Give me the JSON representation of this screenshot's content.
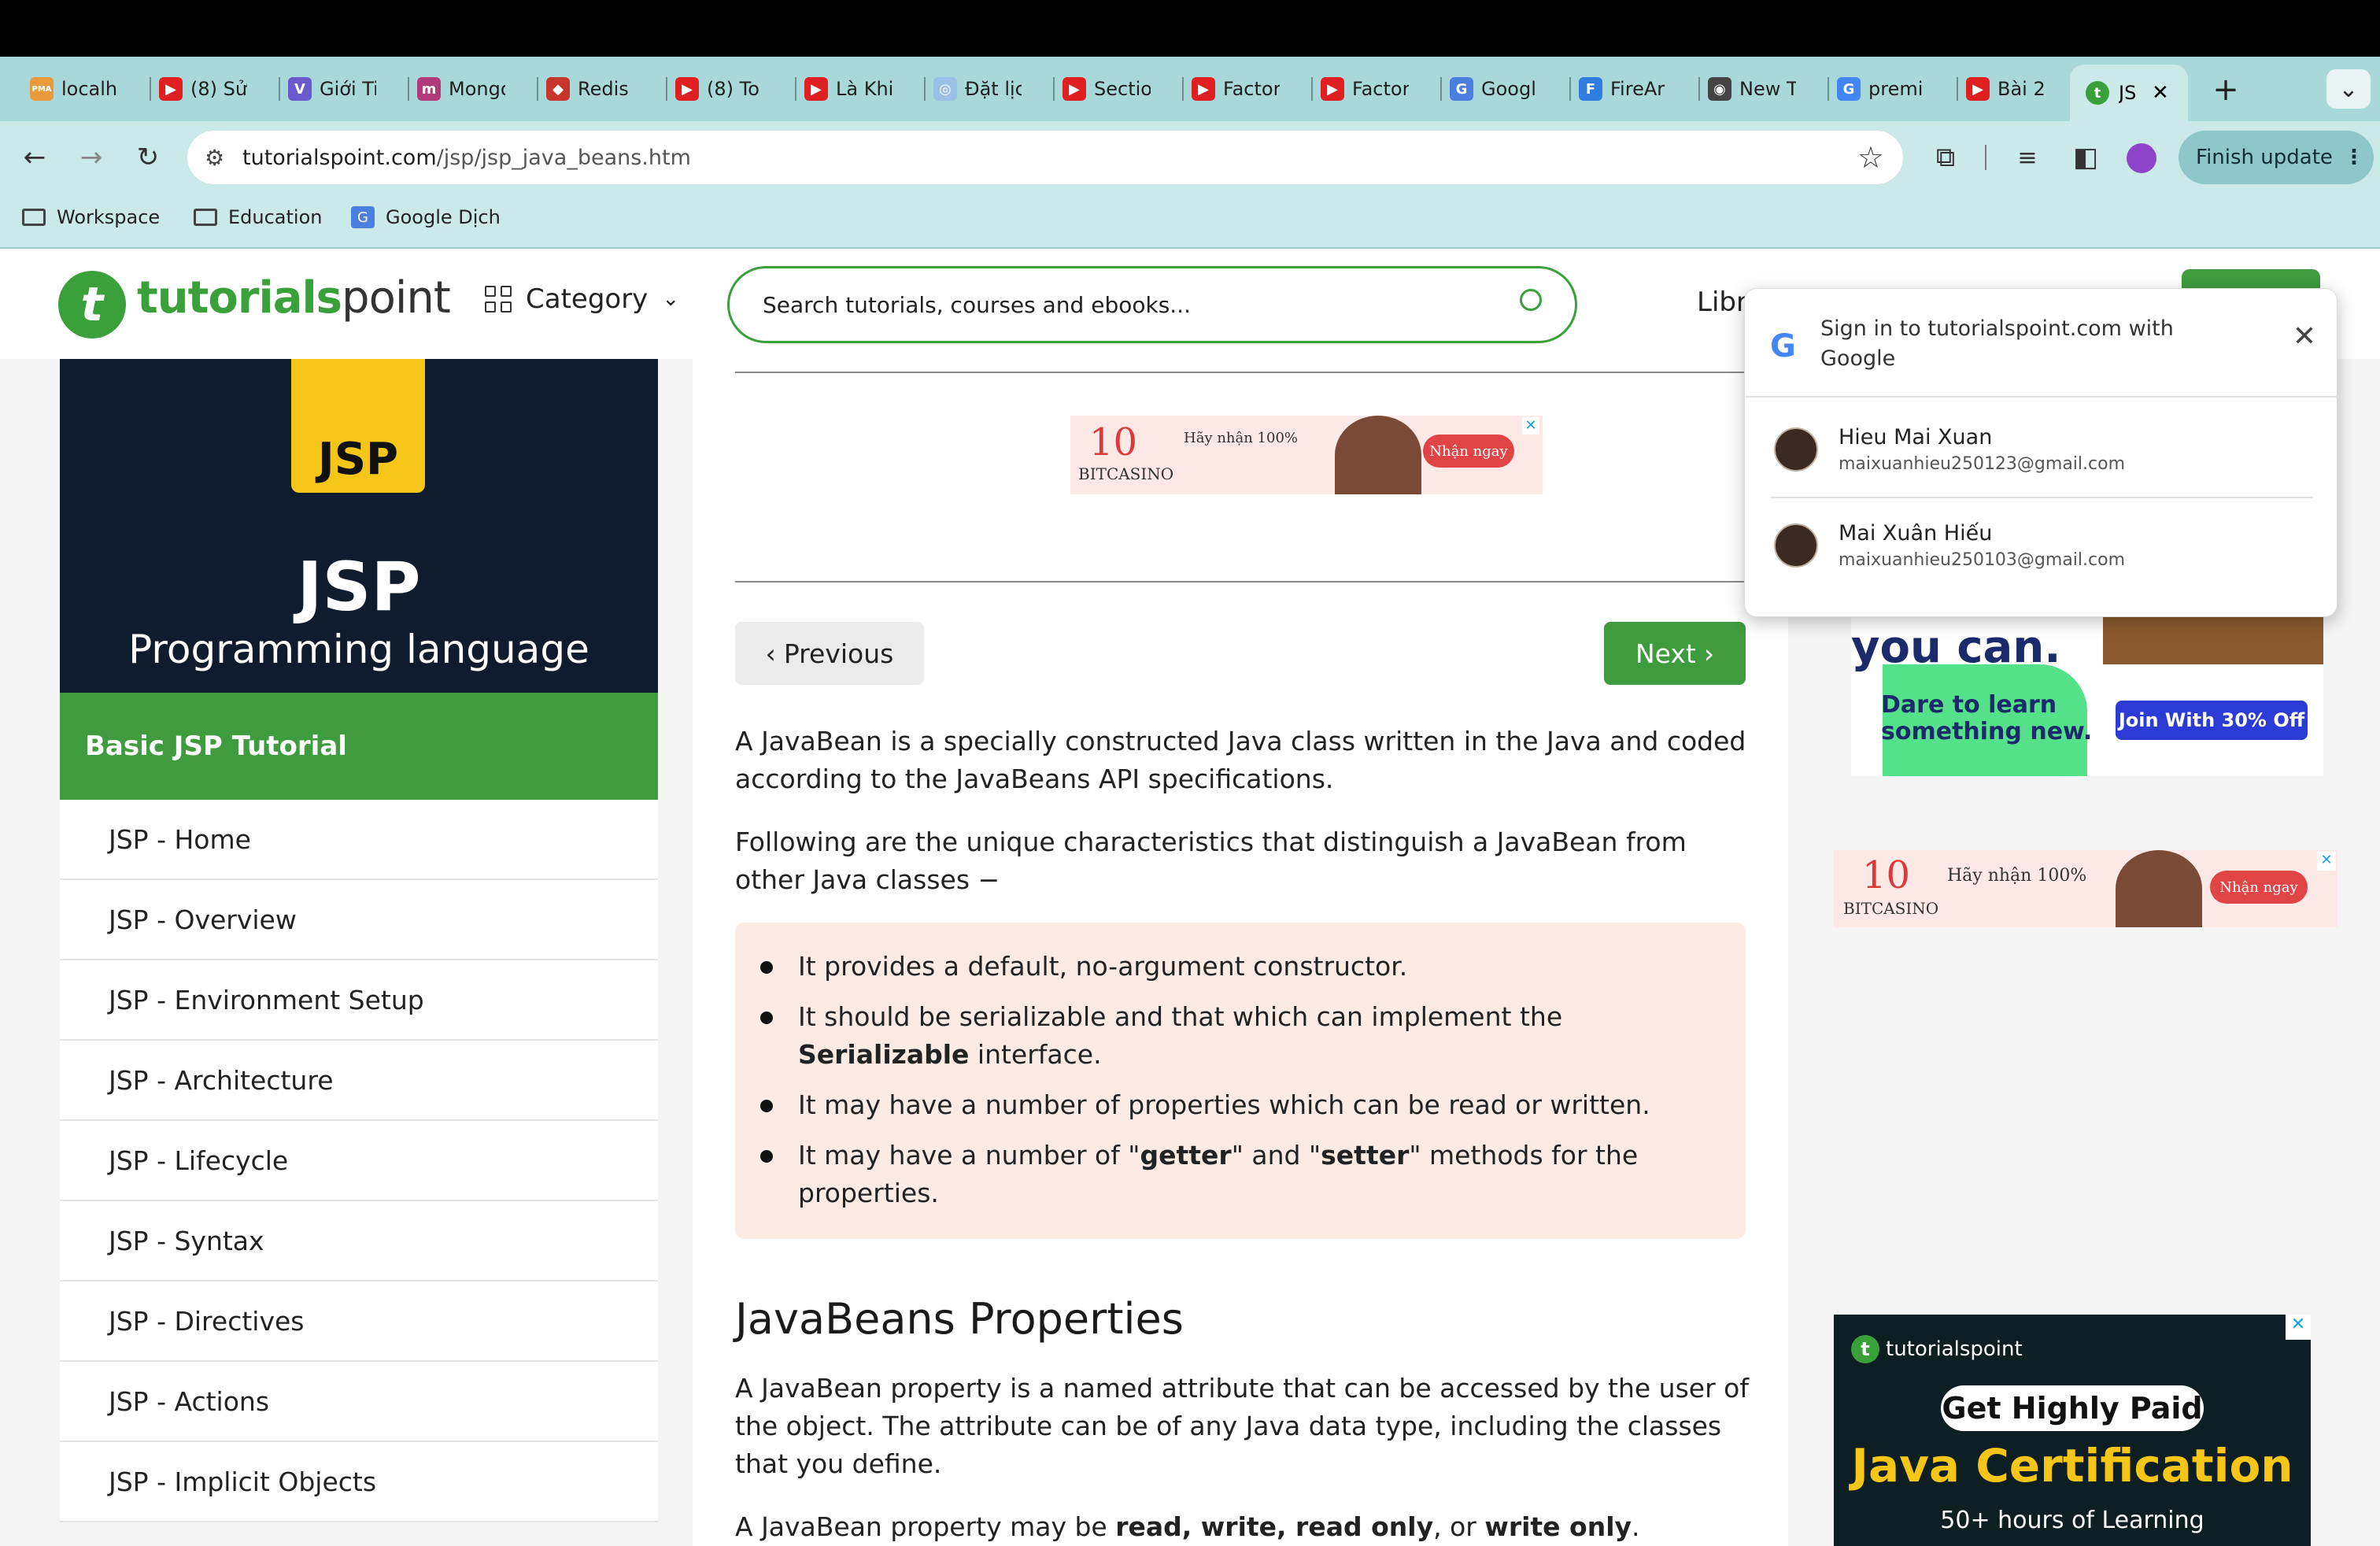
{
  "browser": {
    "tabs": [
      {
        "title": "localh",
        "color": "#e99b3b",
        "glyph": "PMA"
      },
      {
        "title": "(8) Sử",
        "color": "#e02020",
        "glyph": "▶"
      },
      {
        "title": "Giới Ti",
        "color": "#6a5acd",
        "glyph": "V"
      },
      {
        "title": "Mongo",
        "color": "#b23a7a",
        "glyph": "m"
      },
      {
        "title": "Redis",
        "color": "#c8362b",
        "glyph": "◆"
      },
      {
        "title": "(8) To",
        "color": "#e02020",
        "glyph": "▶"
      },
      {
        "title": "Là Khi",
        "color": "#e02020",
        "glyph": "▶"
      },
      {
        "title": "Đặt lịc",
        "color": "#9bc0e8",
        "glyph": "◎"
      },
      {
        "title": "Sectio",
        "color": "#e02020",
        "glyph": "▶"
      },
      {
        "title": "Factor",
        "color": "#e02020",
        "glyph": "▶"
      },
      {
        "title": "Factor",
        "color": "#e02020",
        "glyph": "▶"
      },
      {
        "title": "Googl",
        "color": "#4a7fe0",
        "glyph": "G"
      },
      {
        "title": "FireAr",
        "color": "#2f7de1",
        "glyph": "F"
      },
      {
        "title": "New T",
        "color": "#444444",
        "glyph": "◉"
      },
      {
        "title": "premi",
        "color": "#4285f4",
        "glyph": "G"
      },
      {
        "title": "Bài 2:",
        "color": "#e02020",
        "glyph": "▶"
      }
    ],
    "active_tab": {
      "title": "JS",
      "close": "✕"
    },
    "new_tab": "+",
    "tab_menu": "⌄",
    "url": {
      "host": "tutorialspoint.com",
      "path": "/jsp/jsp_java_beans.htm"
    },
    "finish_update": "Finish update",
    "bookmarks": [
      "Workspace",
      "Education",
      "Google Dịch"
    ]
  },
  "site": {
    "logo": {
      "bold": "tutorials",
      "light": "point",
      "mark": "t"
    },
    "category": "Category",
    "search_placeholder": "Search tutorials, courses and ebooks...",
    "library_partial": "Libr"
  },
  "sidebar": {
    "banner_badge": "JSP",
    "banner_title": "JSP",
    "banner_subtitle": "Programming language",
    "heading": "Basic JSP Tutorial",
    "items": [
      "JSP - Home",
      "JSP - Overview",
      "JSP - Environment Setup",
      "JSP - Architecture",
      "JSP - Lifecycle",
      "JSP - Syntax",
      "JSP - Directives",
      "JSP - Actions",
      "JSP - Implicit Objects"
    ]
  },
  "ads": {
    "casino_brand": "BITCASINO",
    "casino_years": "10",
    "casino_text": "Hãy nhận 100%",
    "casino_cta": "Nhận ngay",
    "promo_headline": "you can.",
    "promo_sub1": "Dare to learn",
    "promo_sub2": "something new.",
    "promo_cta": "Join With 30% Off",
    "cert_brand": "tutorialspoint",
    "cert_line1": "Get Highly Paid",
    "cert_line2": "Java Certification",
    "cert_line3": "50+ hours of Learning"
  },
  "content": {
    "prev": "Previous",
    "next": "Next",
    "intro": "A JavaBean is a specially constructed Java class written in the Java and coded according to the JavaBeans API specifications.",
    "following": "Following are the unique characteristics that distinguish a JavaBean from other Java classes −",
    "bullets": {
      "b1": "It provides a default, no-argument constructor.",
      "b2_pre": "It should be serializable and that which can implement the ",
      "b2_bold": "Serializable",
      "b2_post": " interface.",
      "b3": "It may have a number of properties which can be read or written.",
      "b4_pre": "It may have a number of \"",
      "b4_bold1": "getter",
      "b4_mid": "\" and \"",
      "b4_bold2": "setter",
      "b4_post": "\" methods for the properties."
    },
    "h2": "JavaBeans Properties",
    "prop_desc": "A JavaBean property is a named attribute that can be accessed by the user of the object. The attribute can be of any Java data type, including the classes that you define.",
    "last_pre": "A JavaBean property may be ",
    "last_bold1": "read, write, read only",
    "last_mid": ", or ",
    "last_bold2": "write only",
    "last_post": "."
  },
  "signin_popup": {
    "title": "Sign in to tutorialspoint.com with Google",
    "accounts": [
      {
        "name": "Hieu Mai Xuan",
        "email": "maixuanhieu250123@gmail.com"
      },
      {
        "name": "Mai Xuân Hiếu",
        "email": "maixuanhieu250103@gmail.com"
      }
    ]
  }
}
